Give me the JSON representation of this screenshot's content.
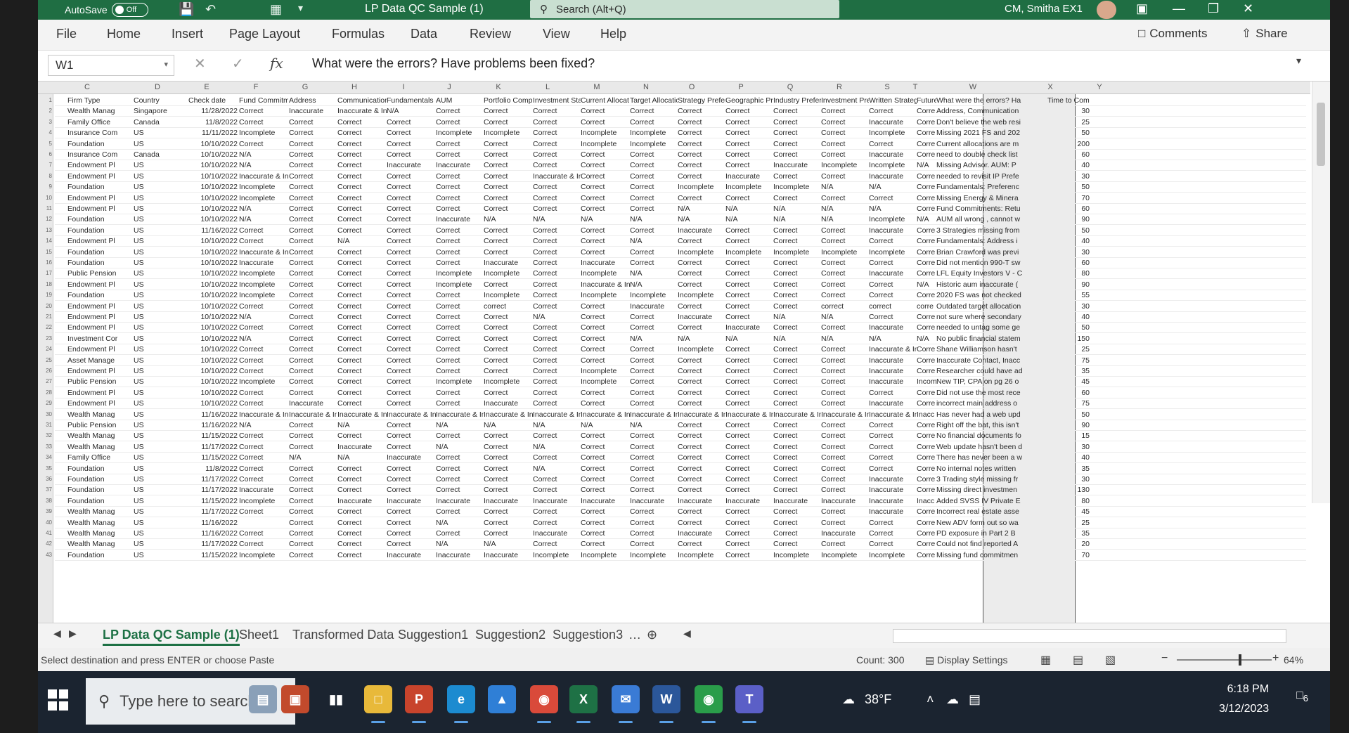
{
  "titlebar": {
    "autosave_label": "AutoSave",
    "autosave_state": "Off",
    "title": "LP Data QC Sample (1)",
    "search_placeholder": "Search (Alt+Q)",
    "user": "CM, Smitha EX1"
  },
  "menu": [
    "File",
    "Home",
    "Insert",
    "Page Layout",
    "Formulas",
    "Data",
    "Review",
    "View",
    "Help"
  ],
  "menu_right": {
    "comments": "Comments",
    "share": "Share"
  },
  "formula_bar": {
    "name_box": "W1",
    "formula": "What were the errors? Have problems been fixed?"
  },
  "columns": [
    "C",
    "D",
    "E",
    "F",
    "G",
    "H",
    "I",
    "J",
    "K",
    "L",
    "M",
    "N",
    "O",
    "P",
    "Q",
    "R",
    "S",
    "T",
    "W",
    "X",
    "Y"
  ],
  "headers": [
    "Firm Type",
    "Country",
    "Check date",
    "Fund Commitm",
    "Address",
    "Communication",
    "Fundamentals",
    "AUM",
    "Portfolio Comp",
    "Investment Sta",
    "Current Allocat",
    "Target Allocatio",
    "Strategy Prefer",
    "Geographic Pre",
    "Industry Prefere",
    "Investment Pre",
    "Written Strateg",
    "Future",
    "What were the errors? Ha",
    "Time to Complete"
  ],
  "rows": [
    [
      "Wealth Manag",
      "Singapore",
      "11/28/2022",
      "Correct",
      "Inaccurate",
      "Inaccurate & In",
      "N/A",
      "Correct",
      "Correct",
      "Correct",
      "Correct",
      "Correct",
      "Correct",
      "Correct",
      "Correct",
      "Correct",
      "Correct",
      "Corre",
      "Address, Communication",
      "30"
    ],
    [
      "Family Office",
      "Canada",
      "11/8/2022",
      "Correct",
      "Correct",
      "Correct",
      "Correct",
      "Correct",
      "Correct",
      "Correct",
      "Correct",
      "Correct",
      "Correct",
      "Correct",
      "Correct",
      "Correct",
      "Inaccurate",
      "Corre",
      "Don't believe the web resi",
      "25"
    ],
    [
      "Insurance Com",
      "US",
      "11/11/2022",
      "Incomplete",
      "Correct",
      "Correct",
      "Correct",
      "Incomplete",
      "Incomplete",
      "Correct",
      "Incomplete",
      "Incomplete",
      "Correct",
      "Correct",
      "Correct",
      "Correct",
      "Incomplete",
      "Corre",
      "Missing 2021 FS and 202",
      "50"
    ],
    [
      "Foundation",
      "US",
      "10/10/2022",
      "Correct",
      "Correct",
      "Correct",
      "Correct",
      "Correct",
      "Correct",
      "Correct",
      "Incomplete",
      "Incomplete",
      "Correct",
      "Correct",
      "Correct",
      "Correct",
      "Correct",
      "Corre",
      "Current allocations are m",
      "200"
    ],
    [
      "Insurance Com",
      "Canada",
      "10/10/2022",
      "N/A",
      "Correct",
      "Correct",
      "Correct",
      "Correct",
      "Correct",
      "Correct",
      "Correct",
      "Correct",
      "Correct",
      "Correct",
      "Correct",
      "Correct",
      "Inaccurate",
      "Corre",
      "need to double check list",
      "60"
    ],
    [
      "Endowment Pl",
      "US",
      "10/10/2022",
      "N/A",
      "Correct",
      "Correct",
      "Inaccurate",
      "Inaccurate",
      "Correct",
      "Correct",
      "Correct",
      "Correct",
      "Correct",
      "Correct",
      "Inaccurate",
      "Incomplete",
      "Incomplete",
      "N/A",
      "Missing Advisor. AUM: P",
      "40"
    ],
    [
      "Endowment Pl",
      "US",
      "10/10/2022",
      "Inaccurate & In",
      "Correct",
      "Correct",
      "Correct",
      "Correct",
      "Correct",
      "Inaccurate & In",
      "Correct",
      "Correct",
      "Correct",
      "Inaccurate",
      "Correct",
      "Correct",
      "Inaccurate",
      "Corre",
      "needed to revisit IP Prefe",
      "30"
    ],
    [
      "Foundation",
      "US",
      "10/10/2022",
      "Incomplete",
      "Correct",
      "Correct",
      "Correct",
      "Correct",
      "Correct",
      "Correct",
      "Correct",
      "Correct",
      "Incomplete",
      "Incomplete",
      "Incomplete",
      "N/A",
      "N/A",
      "Corre",
      "Fundamentals: Preferenc",
      "50"
    ],
    [
      "Endowment Pl",
      "US",
      "10/10/2022",
      "Incomplete",
      "Correct",
      "Correct",
      "Correct",
      "Correct",
      "Correct",
      "Correct",
      "Correct",
      "Correct",
      "Correct",
      "Correct",
      "Correct",
      "Correct",
      "Correct",
      "Corre",
      "Missing Energy & Minera",
      "70"
    ],
    [
      "Endowment Pl",
      "US",
      "10/10/2022",
      "N/A",
      "Correct",
      "Correct",
      "Correct",
      "Correct",
      "Correct",
      "Correct",
      "Correct",
      "Correct",
      "N/A",
      "N/A",
      "N/A",
      "N/A",
      "N/A",
      "Corre",
      "Fund Commitments: Retu",
      "60"
    ],
    [
      "Foundation",
      "US",
      "10/10/2022",
      "N/A",
      "Correct",
      "Correct",
      "Correct",
      "Inaccurate",
      "N/A",
      "N/A",
      "N/A",
      "N/A",
      "N/A",
      "N/A",
      "N/A",
      "N/A",
      "Incomplete",
      "N/A",
      "AUM all wrong , cannot w",
      "90"
    ],
    [
      "Foundation",
      "US",
      "11/16/2022",
      "Correct",
      "Correct",
      "Correct",
      "Correct",
      "Correct",
      "Correct",
      "Correct",
      "Correct",
      "Correct",
      "Inaccurate",
      "Correct",
      "Correct",
      "Correct",
      "Inaccurate",
      "Corre",
      "3 Strategies missing from",
      "50"
    ],
    [
      "Endowment Pl",
      "US",
      "10/10/2022",
      "Correct",
      "Correct",
      "N/A",
      "Correct",
      "Correct",
      "Correct",
      "Correct",
      "Correct",
      "N/A",
      "Correct",
      "Correct",
      "Correct",
      "Correct",
      "Correct",
      "Corre",
      "Fundamentals: Address i",
      "40"
    ],
    [
      "Foundation",
      "US",
      "10/10/2022",
      "Inaccurate & In",
      "Correct",
      "Correct",
      "Correct",
      "Correct",
      "Correct",
      "Correct",
      "Correct",
      "Correct",
      "Incomplete",
      "Incomplete",
      "Incomplete",
      "Incomplete",
      "Incomplete",
      "Corre",
      "Brian Crawford was previ",
      "30"
    ],
    [
      "Foundation",
      "US",
      "10/10/2022",
      "Inaccurate",
      "Correct",
      "Correct",
      "Correct",
      "Correct",
      "Inaccurate",
      "Correct",
      "Inaccurate",
      "Correct",
      "Correct",
      "Correct",
      "Correct",
      "Correct",
      "Correct",
      "Corre",
      "Did not mention 990-T sw",
      "60"
    ],
    [
      "Public Pension",
      "US",
      "10/10/2022",
      "Incomplete",
      "Correct",
      "Correct",
      "Correct",
      "Incomplete",
      "Incomplete",
      "Correct",
      "Incomplete",
      "N/A",
      "Correct",
      "Correct",
      "Correct",
      "Correct",
      "Inaccurate",
      "Corre",
      "LFL Equity Investors V - C",
      "80"
    ],
    [
      "Endowment Pl",
      "US",
      "10/10/2022",
      "Incomplete",
      "Correct",
      "Correct",
      "Correct",
      "Incomplete",
      "Correct",
      "Correct",
      "Inaccurate & In",
      "N/A",
      "Correct",
      "Correct",
      "Correct",
      "Correct",
      "Correct",
      "N/A",
      "Historic aum inaccurate (",
      "90"
    ],
    [
      "Foundation",
      "US",
      "10/10/2022",
      "Incomplete",
      "Correct",
      "Correct",
      "Correct",
      "Correct",
      "Incomplete",
      "Correct",
      "Incomplete",
      "Incomplete",
      "Incomplete",
      "Correct",
      "Correct",
      "Correct",
      "Correct",
      "Corre",
      "2020 FS was not checked",
      "55"
    ],
    [
      "Endowment Pl",
      "US",
      "10/10/2022",
      "Correct",
      "Correct",
      "Correct",
      "Correct",
      "Correct",
      "correct",
      "Correct",
      "Correct",
      "Inaccurate",
      "Correct",
      "Correct",
      "Correct",
      "correct",
      "correct",
      "corre",
      "Outdated target allocation",
      "30"
    ],
    [
      "Endowment Pl",
      "US",
      "10/10/2022",
      "N/A",
      "Correct",
      "Correct",
      "Correct",
      "Correct",
      "Correct",
      "N/A",
      "Correct",
      "Correct",
      "Inaccurate",
      "Correct",
      "N/A",
      "N/A",
      "Correct",
      "Corre",
      "not sure where secondary",
      "40"
    ],
    [
      "Endowment Pl",
      "US",
      "10/10/2022",
      "Correct",
      "Correct",
      "Correct",
      "Correct",
      "Correct",
      "Correct",
      "Correct",
      "Correct",
      "Correct",
      "Correct",
      "Inaccurate",
      "Correct",
      "Correct",
      "Inaccurate",
      "Corre",
      "needed to untag some ge",
      "50"
    ],
    [
      "Investment Cor",
      "US",
      "10/10/2022",
      "N/A",
      "Correct",
      "Correct",
      "Correct",
      "Correct",
      "Correct",
      "Correct",
      "Correct",
      "N/A",
      "N/A",
      "N/A",
      "N/A",
      "N/A",
      "N/A",
      "N/A",
      "No public financial statem",
      "150"
    ],
    [
      "Endowment Pl",
      "US",
      "10/10/2022",
      "Correct",
      "Correct",
      "Correct",
      "Correct",
      "Correct",
      "Correct",
      "Correct",
      "Correct",
      "Correct",
      "Incomplete",
      "Correct",
      "Correct",
      "Correct",
      "Inaccurate & In",
      "Corre",
      "Shane Williamson hasn't",
      "25"
    ],
    [
      "Asset Manage",
      "US",
      "10/10/2022",
      "Correct",
      "Correct",
      "Correct",
      "Correct",
      "Correct",
      "Correct",
      "Correct",
      "Correct",
      "Correct",
      "Correct",
      "Correct",
      "Correct",
      "Correct",
      "Inaccurate",
      "Corre",
      "Inaccurate Contact, Inacc",
      "75"
    ],
    [
      "Endowment Pl",
      "US",
      "10/10/2022",
      "Correct",
      "Correct",
      "Correct",
      "Correct",
      "Correct",
      "Correct",
      "Correct",
      "Incomplete",
      "Correct",
      "Correct",
      "Correct",
      "Correct",
      "Correct",
      "Inaccurate",
      "Corre",
      "Researcher could have ad",
      "35"
    ],
    [
      "Public Pension",
      "US",
      "10/10/2022",
      "Incomplete",
      "Correct",
      "Correct",
      "Correct",
      "Incomplete",
      "Incomplete",
      "Correct",
      "Incomplete",
      "Correct",
      "Correct",
      "Correct",
      "Correct",
      "Correct",
      "Inaccurate",
      "Incom",
      "New TIP, CPA on pg 26 o",
      "45"
    ],
    [
      "Endowment Pl",
      "US",
      "10/10/2022",
      "Correct",
      "Correct",
      "Correct",
      "Correct",
      "Correct",
      "Correct",
      "Correct",
      "Correct",
      "Correct",
      "Correct",
      "Correct",
      "Correct",
      "Correct",
      "Correct",
      "Corre",
      "Did not use the most rece",
      "60"
    ],
    [
      "Endowment Pl",
      "US",
      "10/10/2022",
      "Correct",
      "Inaccurate",
      "Correct",
      "Correct",
      "Correct",
      "Inaccurate",
      "Correct",
      "Correct",
      "Correct",
      "Correct",
      "Correct",
      "Correct",
      "Correct",
      "Inaccurate",
      "Corre",
      "incorrect main address o",
      "75"
    ],
    [
      "Wealth Manag",
      "US",
      "11/16/2022",
      "Inaccurate & In",
      "Inaccurate & In",
      "Inaccurate & In",
      "Inaccurate & In",
      "Inaccurate & In",
      "Inaccurate & In",
      "Inaccurate & In",
      "Inaccurate & In",
      "Inaccurate & In",
      "Inaccurate & In",
      "Inaccurate & In",
      "Inaccurate & In",
      "Inaccurate & In",
      "Inaccurate & In",
      "Inacc",
      "Has never had a web upd",
      "50"
    ],
    [
      "Public Pension",
      "US",
      "11/16/2022",
      "N/A",
      "Correct",
      "N/A",
      "Correct",
      "N/A",
      "N/A",
      "N/A",
      "N/A",
      "N/A",
      "Correct",
      "Correct",
      "Correct",
      "Correct",
      "Correct",
      "Corre",
      "Right off the bat, this isn't",
      "90"
    ],
    [
      "Wealth Manag",
      "US",
      "11/15/2022",
      "Correct",
      "Correct",
      "Correct",
      "Correct",
      "Correct",
      "Correct",
      "Correct",
      "Correct",
      "Correct",
      "Correct",
      "Correct",
      "Correct",
      "Correct",
      "Correct",
      "Corre",
      "No financial documents fo",
      "15"
    ],
    [
      "Wealth Manag",
      "US",
      "11/17/2022",
      "Correct",
      "Correct",
      "Inaccurate",
      "Correct",
      "N/A",
      "Correct",
      "N/A",
      "Correct",
      "Correct",
      "Correct",
      "Correct",
      "Correct",
      "Correct",
      "Correct",
      "Corre",
      "Web update hasn't been d",
      "30"
    ],
    [
      "Family Office",
      "US",
      "11/15/2022",
      "Correct",
      "N/A",
      "N/A",
      "Inaccurate",
      "Correct",
      "Correct",
      "Correct",
      "Correct",
      "Correct",
      "Correct",
      "Correct",
      "Correct",
      "Correct",
      "Correct",
      "Corre",
      "There has never been a w",
      "40"
    ],
    [
      "Foundation",
      "US",
      "11/8/2022",
      "Correct",
      "Correct",
      "Correct",
      "Correct",
      "Correct",
      "Correct",
      "N/A",
      "Correct",
      "Correct",
      "Correct",
      "Correct",
      "Correct",
      "Correct",
      "Correct",
      "Corre",
      "No internal notes written",
      "35"
    ],
    [
      "Foundation",
      "US",
      "11/17/2022",
      "Correct",
      "Correct",
      "Correct",
      "Correct",
      "Correct",
      "Correct",
      "Correct",
      "Correct",
      "Correct",
      "Correct",
      "Correct",
      "Correct",
      "Correct",
      "Inaccurate",
      "Corre",
      "3 Trading style missing fr",
      "30"
    ],
    [
      "Foundation",
      "US",
      "11/17/2022",
      "Inaccurate",
      "Correct",
      "Correct",
      "Correct",
      "Correct",
      "Correct",
      "Correct",
      "Correct",
      "Correct",
      "Correct",
      "Correct",
      "Correct",
      "Correct",
      "Inaccurate",
      "Corre",
      "Missing direct investmen",
      "130"
    ],
    [
      "Foundation",
      "US",
      "11/15/2022",
      "Incomplete",
      "Correct",
      "Inaccurate",
      "Inaccurate",
      "Inaccurate",
      "Inaccurate",
      "Inaccurate",
      "Inaccurate",
      "Inaccurate",
      "Inaccurate",
      "Inaccurate",
      "Inaccurate",
      "Inaccurate",
      "Inaccurate",
      "Inacc",
      "Added SVSS IV Private E",
      "80"
    ],
    [
      "Wealth Manag",
      "US",
      "11/17/2022",
      "Correct",
      "Correct",
      "Correct",
      "Correct",
      "Correct",
      "Correct",
      "Correct",
      "Correct",
      "Correct",
      "Correct",
      "Correct",
      "Correct",
      "Correct",
      "Inaccurate",
      "Corre",
      "Incorrect real estate asse",
      "45"
    ],
    [
      "Wealth Manag",
      "US",
      "11/16/2022",
      "",
      "Correct",
      "Correct",
      "Correct",
      "N/A",
      "Correct",
      "Correct",
      "Correct",
      "Correct",
      "Correct",
      "Correct",
      "Correct",
      "Correct",
      "Correct",
      "Corre",
      "New ADV form out so wa",
      "25"
    ],
    [
      "Wealth Manag",
      "US",
      "11/16/2022",
      "Correct",
      "Correct",
      "Correct",
      "Correct",
      "Correct",
      "Correct",
      "Inaccurate",
      "Correct",
      "Correct",
      "Inaccurate",
      "Correct",
      "Correct",
      "Inaccurate",
      "Correct",
      "Corre",
      "PD exposure in Part 2 B",
      "35"
    ],
    [
      "Wealth Manag",
      "US",
      "11/17/2022",
      "Correct",
      "Correct",
      "Correct",
      "Correct",
      "N/A",
      "N/A",
      "Correct",
      "Correct",
      "Correct",
      "Correct",
      "Correct",
      "Correct",
      "Correct",
      "Correct",
      "Corre",
      "Could not find reported A",
      "20"
    ],
    [
      "Foundation",
      "US",
      "11/15/2022",
      "Incomplete",
      "Correct",
      "Correct",
      "Inaccurate",
      "Inaccurate",
      "Inaccurate",
      "Incomplete",
      "Incomplete",
      "Incomplete",
      "Incomplete",
      "Correct",
      "Incomplete",
      "Incomplete",
      "Incomplete",
      "Corre",
      "Missing fund commitmen",
      "70"
    ]
  ],
  "sheet_tabs": [
    "LP Data QC Sample (1)",
    "Sheet1",
    "Transformed Data",
    "Suggestion1",
    "Suggestion2",
    "Suggestion3"
  ],
  "status": {
    "message": "Select destination and press ENTER or choose Paste",
    "count": "Count: 300",
    "display_settings": "Display Settings",
    "zoom": "64%"
  },
  "taskbar": {
    "search_placeholder": "Type here to search",
    "temperature": "38°F",
    "time": "6:18 PM",
    "date": "3/12/2023",
    "notification_count": "6"
  }
}
